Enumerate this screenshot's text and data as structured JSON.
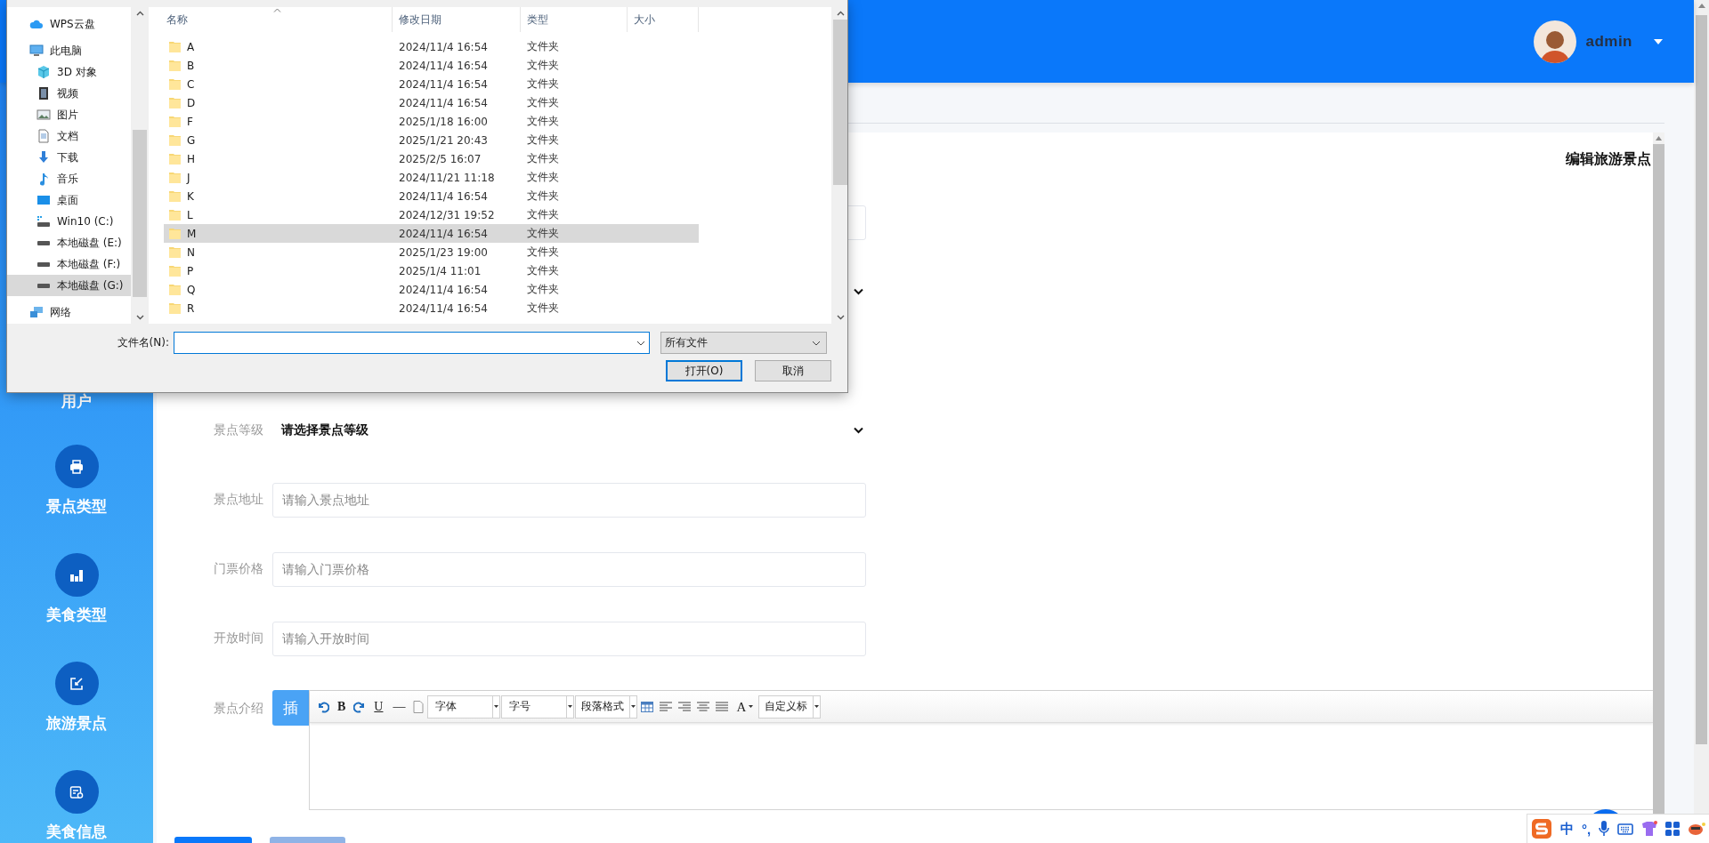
{
  "header": {
    "user": {
      "name": "admin"
    }
  },
  "sidebar": {
    "items": [
      {
        "label": "用户"
      },
      {
        "label": "景点类型",
        "kind": "printer"
      },
      {
        "label": "美食类型",
        "kind": "chart"
      },
      {
        "label": "旅游景点",
        "kind": "export"
      },
      {
        "label": "美食信息",
        "kind": "card"
      }
    ]
  },
  "card": {
    "title": "编辑旅游景点"
  },
  "form": {
    "fields": [
      {
        "kind": "input"
      },
      {
        "kind": "select"
      },
      {
        "kind": "select",
        "label": "景点等级",
        "value": "请选择景点等级"
      },
      {
        "kind": "input",
        "label": "景点地址",
        "placeholder": "请输入景点地址"
      },
      {
        "kind": "input",
        "label": "门票价格",
        "placeholder": "请输入门票价格"
      },
      {
        "kind": "input",
        "label": "开放时间",
        "placeholder": "请输入开放时间"
      }
    ],
    "editor": {
      "label": "景点介绍",
      "insert_button": "插",
      "toolbar": [
        {
          "kind": "undo"
        },
        {
          "kind": "bold",
          "text": "B"
        },
        {
          "kind": "redo"
        },
        {
          "kind": "underline",
          "text": "U"
        },
        {
          "kind": "rule",
          "text": "—"
        },
        {
          "kind": "page"
        },
        {
          "kind": "select",
          "text": "字体"
        },
        {
          "kind": "select",
          "text": "字号"
        },
        {
          "kind": "select",
          "text": "段落格式"
        },
        {
          "kind": "table"
        },
        {
          "kind": "align-left"
        },
        {
          "kind": "align-right"
        },
        {
          "kind": "align-center"
        },
        {
          "kind": "justify"
        },
        {
          "kind": "color",
          "text": "A"
        },
        {
          "kind": "select",
          "text": "自定义标"
        }
      ]
    },
    "buttons": [
      {
        "kind": "primary"
      },
      {
        "kind": "secondary"
      }
    ]
  },
  "file_dialog": {
    "nav": [
      {
        "label": "WPS云盘",
        "kind": "cloud",
        "selected": false
      },
      {
        "label": "此电脑",
        "kind": "pc",
        "selected": false,
        "children": [
          {
            "label": "3D 对象",
            "kind": "cube",
            "selected": false
          },
          {
            "label": "视频",
            "kind": "video",
            "selected": false
          },
          {
            "label": "图片",
            "kind": "picture",
            "selected": false
          },
          {
            "label": "文档",
            "kind": "document",
            "selected": false
          },
          {
            "label": "下载",
            "kind": "download",
            "selected": false
          },
          {
            "label": "音乐",
            "kind": "music",
            "selected": false
          },
          {
            "label": "桌面",
            "kind": "desktop",
            "selected": false
          },
          {
            "label": "Win10 (C:)",
            "kind": "system-drive",
            "selected": false
          },
          {
            "label": "本地磁盘 (E:)",
            "kind": "drive",
            "selected": false
          },
          {
            "label": "本地磁盘 (F:)",
            "kind": "drive",
            "selected": false
          },
          {
            "label": "本地磁盘 (G:)",
            "kind": "drive",
            "selected": true
          }
        ]
      },
      {
        "label": "网络",
        "kind": "network",
        "selected": false
      }
    ],
    "columns": [
      "名称",
      "修改日期",
      "类型",
      "大小"
    ],
    "rows": [
      {
        "name": "A",
        "modified": "2024/11/4 16:54",
        "type": "文件夹",
        "selected": false
      },
      {
        "name": "B",
        "modified": "2024/11/4 16:54",
        "type": "文件夹",
        "selected": false
      },
      {
        "name": "C",
        "modified": "2024/11/4 16:54",
        "type": "文件夹",
        "selected": false
      },
      {
        "name": "D",
        "modified": "2024/11/4 16:54",
        "type": "文件夹",
        "selected": false
      },
      {
        "name": "F",
        "modified": "2025/1/18 16:00",
        "type": "文件夹",
        "selected": false
      },
      {
        "name": "G",
        "modified": "2025/1/21 20:43",
        "type": "文件夹",
        "selected": false
      },
      {
        "name": "H",
        "modified": "2025/2/5 16:07",
        "type": "文件夹",
        "selected": false
      },
      {
        "name": "J",
        "modified": "2024/11/21 11:18",
        "type": "文件夹",
        "selected": false
      },
      {
        "name": "K",
        "modified": "2024/11/4 16:54",
        "type": "文件夹",
        "selected": false
      },
      {
        "name": "L",
        "modified": "2024/12/31 19:52",
        "type": "文件夹",
        "selected": false
      },
      {
        "name": "M",
        "modified": "2024/11/4 16:54",
        "type": "文件夹",
        "selected": true
      },
      {
        "name": "N",
        "modified": "2025/1/23 19:00",
        "type": "文件夹",
        "selected": false
      },
      {
        "name": "P",
        "modified": "2025/1/4 11:01",
        "type": "文件夹",
        "selected": false
      },
      {
        "name": "Q",
        "modified": "2024/11/4 16:54",
        "type": "文件夹",
        "selected": false
      },
      {
        "name": "R",
        "modified": "2024/11/4 16:54",
        "type": "文件夹",
        "selected": false
      }
    ],
    "filename": {
      "label": "文件名(N):"
    },
    "filter": "所有文件",
    "buttons": [
      {
        "label": "打开(O)",
        "kind": "default"
      },
      {
        "label": "取消",
        "kind": "normal"
      }
    ]
  },
  "ime_bar": {
    "items": [
      {
        "kind": "logo"
      },
      {
        "kind": "text",
        "text": "中"
      },
      {
        "kind": "text",
        "text": "°,"
      },
      {
        "kind": "mic"
      },
      {
        "kind": "keyboard"
      },
      {
        "kind": "skin"
      },
      {
        "kind": "apps"
      },
      {
        "kind": "mascot"
      }
    ]
  }
}
